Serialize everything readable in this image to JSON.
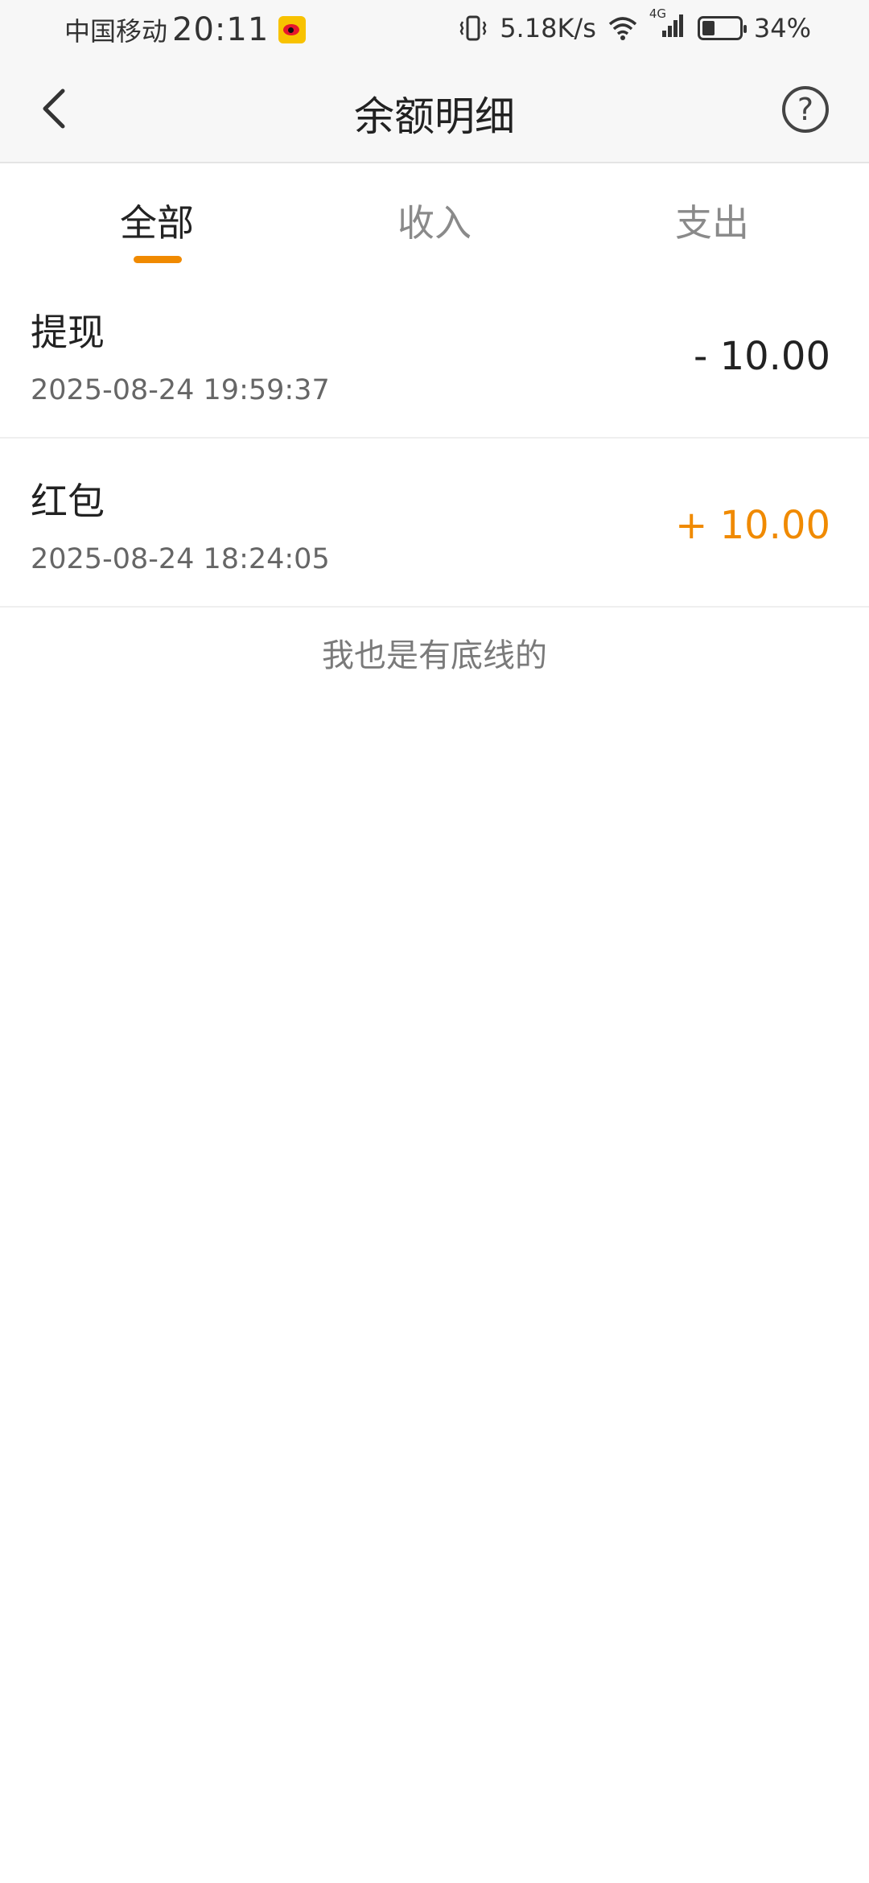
{
  "status_bar": {
    "carrier": "中国移动",
    "time": "20:11",
    "net_speed": "5.18K/s",
    "network_type": "4G",
    "battery_percent": "34%",
    "battery_level": 0.34,
    "icons": [
      "weibo-icon",
      "vibrate-icon",
      "wifi-icon",
      "signal-icon",
      "battery-icon"
    ]
  },
  "header": {
    "title": "余额明细",
    "back_icon": "chevron-left-icon",
    "help_icon": "question-circle-icon",
    "help_symbol": "?"
  },
  "tabs": [
    {
      "label": "全部",
      "active": true
    },
    {
      "label": "收入",
      "active": false
    },
    {
      "label": "支出",
      "active": false
    }
  ],
  "records": [
    {
      "title": "提现",
      "time": "2025-08-24 19:59:37",
      "amount": "- 10.00",
      "type": "expense"
    },
    {
      "title": "红包",
      "time": "2025-08-24 18:24:05",
      "amount": "+ 10.00",
      "type": "income"
    }
  ],
  "footer_note": "我也是有底线的",
  "colors": {
    "accent": "#f08a00",
    "text_primary": "#222222",
    "text_secondary": "#666666",
    "header_bg": "#f7f7f7"
  }
}
